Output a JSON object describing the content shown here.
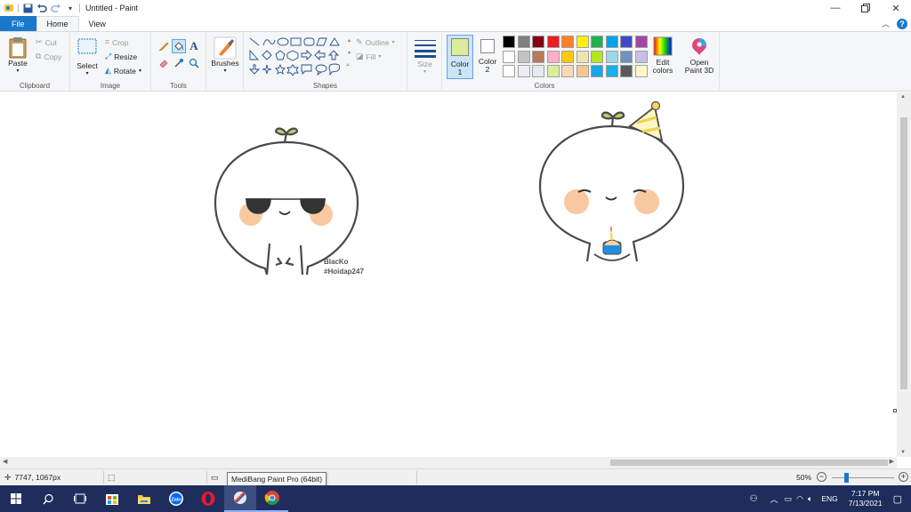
{
  "window": {
    "title": "Untitled - Paint",
    "icons": [
      "paint-app-icon",
      "save-icon",
      "undo-icon",
      "redo-icon",
      "customize-qat-icon"
    ]
  },
  "tabs": [
    {
      "label": "File"
    },
    {
      "label": "Home"
    },
    {
      "label": "View"
    }
  ],
  "ribbon": {
    "clipboard": {
      "paste": "Paste",
      "cut": "Cut",
      "copy": "Copy",
      "label": "Clipboard"
    },
    "image": {
      "select": "Select",
      "crop": "Crop",
      "resize": "Resize",
      "rotate": "Rotate",
      "label": "Image"
    },
    "tools": {
      "label": "Tools"
    },
    "brushes": {
      "label": "Brushes"
    },
    "shapes": {
      "outline": "Outline",
      "fill": "Fill",
      "label": "Shapes"
    },
    "size": {
      "label": "Size"
    },
    "color1": {
      "line1": "Color",
      "line2": "1",
      "value": "#d9ed9a"
    },
    "color2": {
      "line1": "Color",
      "line2": "2",
      "value": "#ffffff"
    },
    "colors": {
      "label": "Colors"
    },
    "edit_colors": {
      "line1": "Edit",
      "line2": "colors"
    },
    "paint3d": {
      "line1": "Open",
      "line2": "Paint 3D"
    }
  },
  "palette": {
    "row1": [
      "#000000",
      "#7f7f7f",
      "#880015",
      "#ed1c24",
      "#ff7f27",
      "#fff200",
      "#22b14c",
      "#00a2e8",
      "#3f48cc",
      "#a349a4"
    ],
    "row2": [
      "#ffffff",
      "#c3c3c3",
      "#b97a57",
      "#ffaec9",
      "#ffc90e",
      "#efe4b0",
      "#b5e61d",
      "#99d9ea",
      "#7092be",
      "#c8bfe7"
    ],
    "row3": [
      "#ffffff",
      "#ececf4",
      "#e7e7f0",
      "#d9ed9a",
      "#fdd7b4",
      "#f6c78f",
      "#1aa5e8",
      "#16b0e9",
      "#5b5b5b",
      "#fff6c6"
    ]
  },
  "canvas": {
    "signature_line1": "BlacKo",
    "signature_line2": "#Hoidap247"
  },
  "status": {
    "cursor_pos": "7747, 1067px",
    "zoom": "50%"
  },
  "tooltip": {
    "text": "MediBang Paint Pro (64bit)"
  },
  "taskbar": {
    "lang": "ENG",
    "time": "7:17 PM",
    "date": "7/13/2021"
  }
}
